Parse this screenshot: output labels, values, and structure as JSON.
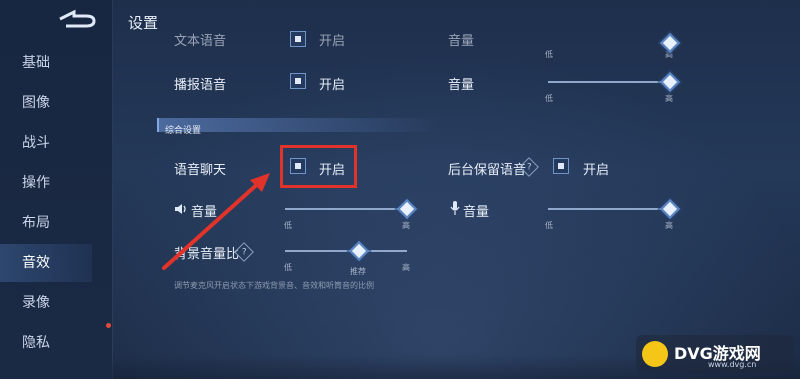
{
  "header": {
    "title": "设置"
  },
  "sidebar": {
    "items": [
      {
        "label": "基础"
      },
      {
        "label": "图像"
      },
      {
        "label": "战斗"
      },
      {
        "label": "操作"
      },
      {
        "label": "布局"
      },
      {
        "label": "音效"
      },
      {
        "label": "录像"
      },
      {
        "label": "隐私"
      }
    ],
    "active_index": 5
  },
  "top_partial": {
    "label": "文本语音",
    "checkbox_label": "开启",
    "volume_label": "音量",
    "low": "低",
    "high": "高"
  },
  "broadcast": {
    "label": "播报语音",
    "checkbox_label": "开启",
    "volume_label": "音量",
    "low": "低",
    "high": "高"
  },
  "section": {
    "title": "综合设置"
  },
  "voice_chat": {
    "label": "语音聊天",
    "checkbox_label": "开启",
    "bg_keep_label": "后台保留语音",
    "bg_checkbox_label": "开启",
    "speaker_volume_label": "音量",
    "mic_volume_label": "音量",
    "low": "低",
    "high": "高"
  },
  "bg_ratio": {
    "label": "背景音量比",
    "low": "低",
    "recommended": "推荐",
    "high": "高",
    "note": "调节麦克风开启状态下游戏背景音、音效和听筒音的比例"
  },
  "watermark": {
    "brand": "DVG游戏网",
    "url": "www.dvg.cn"
  },
  "levels": {
    "broadcast_volume": 1.0,
    "speaker_volume": 1.0,
    "mic_volume": 1.0,
    "bg_ratio": 0.55
  },
  "colors": {
    "accent": "#5a86c4",
    "highlight": "#e2332a"
  }
}
